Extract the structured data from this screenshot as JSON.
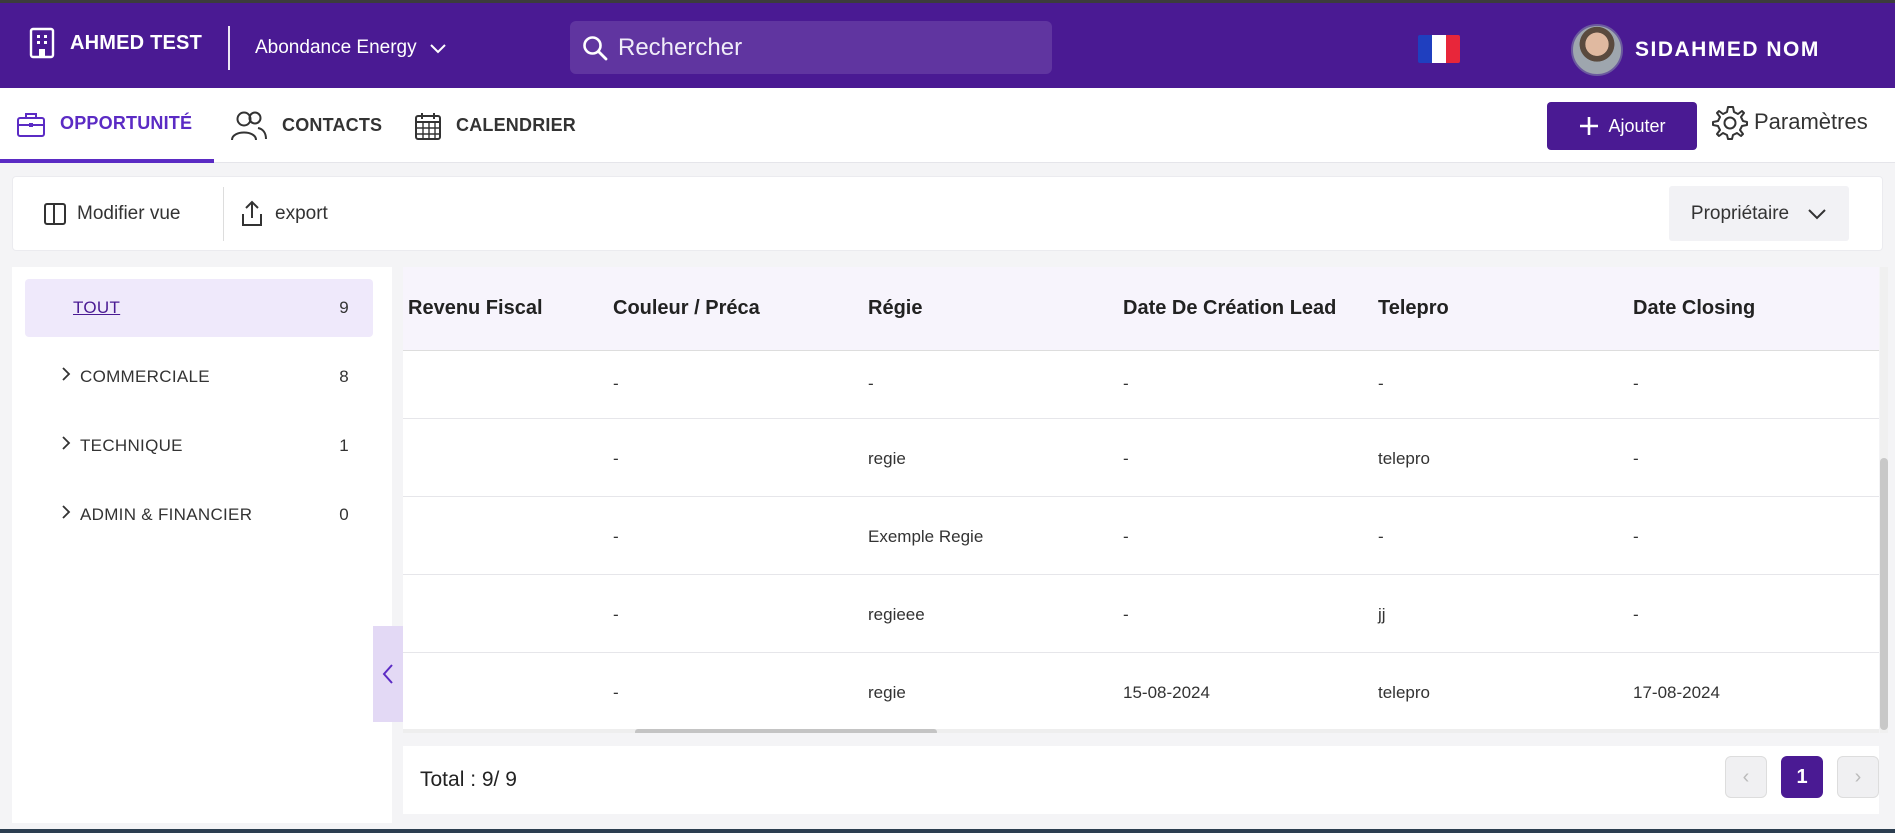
{
  "topbar": {
    "org_name": "AHMED TEST",
    "company": "Abondance Energy",
    "search_placeholder": "Rechercher",
    "user_name": "SIDAHMED NOM",
    "flag": [
      "#1f3fbf",
      "#ffffff",
      "#e8263a"
    ]
  },
  "nav": {
    "tabs": [
      {
        "label": "OPPORTUNITÉ",
        "icon": "briefcase-icon",
        "active": true
      },
      {
        "label": "CONTACTS",
        "icon": "users-icon",
        "active": false
      },
      {
        "label": "CALENDRIER",
        "icon": "calendar-icon",
        "active": false
      }
    ],
    "add_label": "Ajouter",
    "settings_label": "Paramètres"
  },
  "toolbar": {
    "edit_view_label": "Modifier vue",
    "export_label": "export",
    "owner_label": "Propriétaire"
  },
  "sidebar": {
    "items": [
      {
        "label": "TOUT",
        "count": "9"
      },
      {
        "label": "COMMERCIALE",
        "count": "8"
      },
      {
        "label": "TECHNIQUE",
        "count": "1"
      },
      {
        "label": "ADMIN & FINANCIER",
        "count": "0"
      }
    ]
  },
  "table": {
    "columns": [
      "Revenu Fiscal",
      "Couleur / Préca",
      "Régie",
      "Date De Création Lead",
      "Telepro",
      "Date Closing"
    ],
    "rows": [
      [
        "",
        "-",
        "-",
        "-",
        "-",
        "-"
      ],
      [
        "",
        "-",
        "regie",
        "-",
        "telepro",
        "-"
      ],
      [
        "",
        "-",
        "Exemple Regie",
        "-",
        "-",
        "-"
      ],
      [
        "",
        "-",
        "regieee",
        "-",
        "jj",
        "-"
      ],
      [
        "",
        "-",
        "regie",
        "15-08-2024",
        "telepro",
        "17-08-2024"
      ]
    ]
  },
  "footer": {
    "total": "Total : 9/ 9",
    "current_page": "1",
    "prev": "‹",
    "next": "›"
  },
  "colors": {
    "brand": "#4a1a93",
    "accent": "#5b2bc4"
  }
}
